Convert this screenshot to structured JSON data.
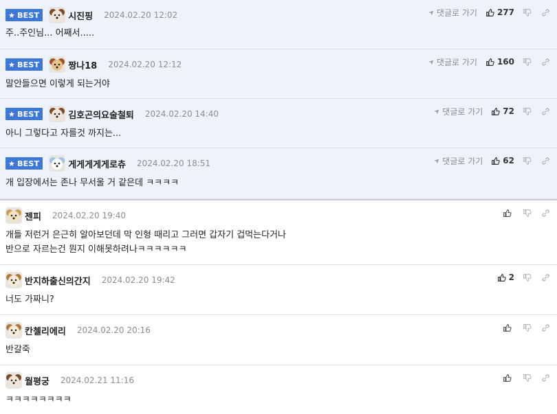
{
  "ui": {
    "best_label": "BEST",
    "reply_label": "댓글로 가기"
  },
  "colors": {
    "best_badge": "#3d78d8",
    "best_bg": "#eef3fb",
    "date_text": "#8a8d93"
  },
  "comments": [
    {
      "best": true,
      "author": "시진핑",
      "date": "2024.02.20 12:02",
      "text": "주..주인님... 어째서.....",
      "likes": "277"
    },
    {
      "best": true,
      "author": "짱나18",
      "date": "2024.02.20 12:12",
      "text": "말안들으면 이렇게 되는거야",
      "likes": "160"
    },
    {
      "best": true,
      "author": "김호곤의요술철퇴",
      "date": "2024.02.20 14:40",
      "text": "아니 그렇다고 자를것 까지는...",
      "likes": "72"
    },
    {
      "best": true,
      "author": "게게게게게로츄",
      "date": "2024.02.20 18:51",
      "text": "개 입장에서는 존나 무서울 거 같은데 ㅋㅋㅋㅋ",
      "likes": "62"
    },
    {
      "best": false,
      "author": "젠피",
      "date": "2024.02.20 19:40",
      "text": "개들 저런거 은근히 알아보던데 막 인형 때리고 그러면 갑자기 겁먹는다거나\n반으로 자르는건 뭔지 이해못하려나ㅋㅋㅋㅋㅋㅋ",
      "likes": ""
    },
    {
      "best": false,
      "author": "반지하출신의간지",
      "date": "2024.02.20 19:42",
      "text": "너도 가짜니?",
      "likes": "2"
    },
    {
      "best": false,
      "author": "칸첼리에리",
      "date": "2024.02.20 20:16",
      "text": "반갈죽",
      "likes": ""
    },
    {
      "best": false,
      "author": "월평궁",
      "date": "2024.02.21 11:16",
      "text": "ㅋㅋㅋㅋㅋㅋㅋㅋ",
      "likes": ""
    }
  ]
}
